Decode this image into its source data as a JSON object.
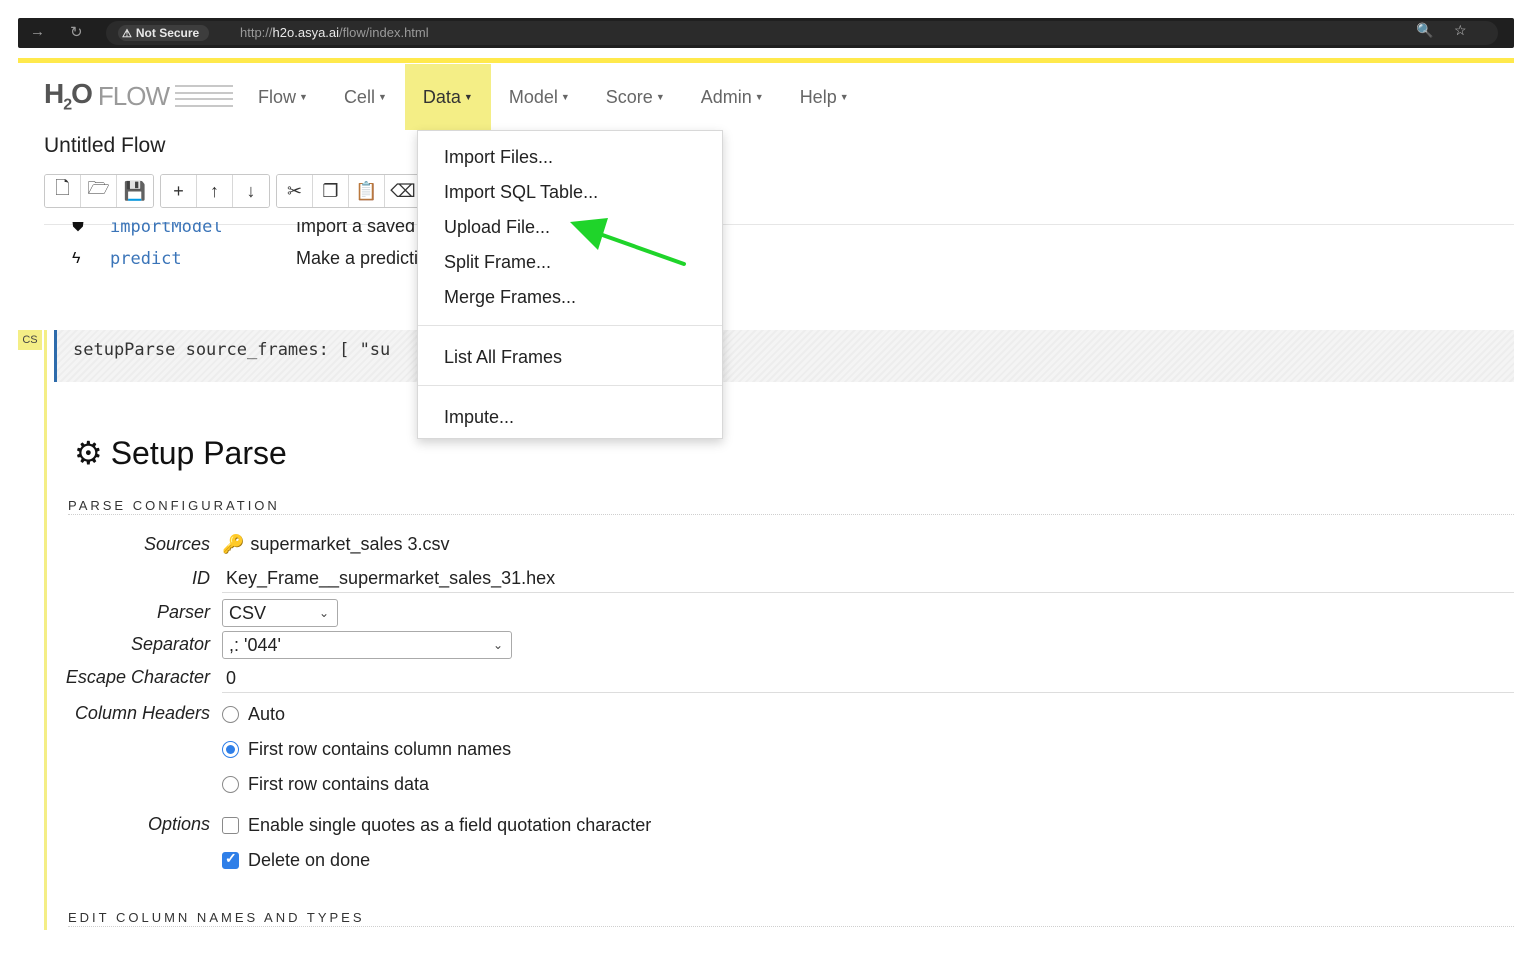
{
  "browser": {
    "security_label": "Not Secure",
    "url_scheme": "http://",
    "url_host": "h2o.asya.ai",
    "url_path": "/flow/index.html"
  },
  "app": {
    "logo_mark": "H",
    "logo_sub": "2",
    "logo_o": "O",
    "logo_word": "FLOW",
    "title": "Untitled Flow"
  },
  "menu": {
    "items": [
      {
        "label": "Flow"
      },
      {
        "label": "Cell"
      },
      {
        "label": "Data"
      },
      {
        "label": "Model"
      },
      {
        "label": "Score"
      },
      {
        "label": "Admin"
      },
      {
        "label": "Help"
      }
    ],
    "active": "Data"
  },
  "toolbar": {
    "icons": [
      "new-file-icon",
      "open-folder-icon",
      "save-icon",
      "add-cell-icon",
      "move-up-icon",
      "move-down-icon",
      "cut-icon",
      "copy-icon",
      "paste-icon",
      "clear-icon"
    ]
  },
  "help_rows": [
    {
      "fn": "importModel",
      "desc": "Import a saved m"
    },
    {
      "fn": "predict",
      "desc": "Make a predictio"
    }
  ],
  "cell": {
    "tag": "CS",
    "code": "setupParse source_frames: [ \"su"
  },
  "setup_parse": {
    "title": "Setup Parse",
    "section1": "PARSE CONFIGURATION",
    "sources_label": "Sources",
    "sources_value": "supermarket_sales 3.csv",
    "id_label": "ID",
    "id_value": "Key_Frame__supermarket_sales_31.hex",
    "parser_label": "Parser",
    "parser_value": "CSV",
    "separator_label": "Separator",
    "separator_value": ",: '044'",
    "escape_label": "Escape Character",
    "escape_value": "0",
    "headers_label": "Column Headers",
    "headers_options": [
      "Auto",
      "First row contains column names",
      "First row contains data"
    ],
    "headers_selected": "First row contains column names",
    "options_label": "Options",
    "option_single_quotes": "Enable single quotes as a field quotation character",
    "option_single_quotes_checked": false,
    "option_delete_on_done": "Delete on done",
    "option_delete_on_done_checked": true,
    "section2": "EDIT COLUMN NAMES AND TYPES"
  },
  "data_menu": {
    "items": [
      "Import Files...",
      "Import SQL Table...",
      "Upload File...",
      "Split Frame...",
      "Merge Frames..."
    ],
    "list_all": "List All Frames",
    "impute": "Impute..."
  },
  "colors": {
    "accent_yellow": "#f4ee86",
    "annotation_arrow": "#1fd42a",
    "link_blue": "#3a74b8"
  }
}
